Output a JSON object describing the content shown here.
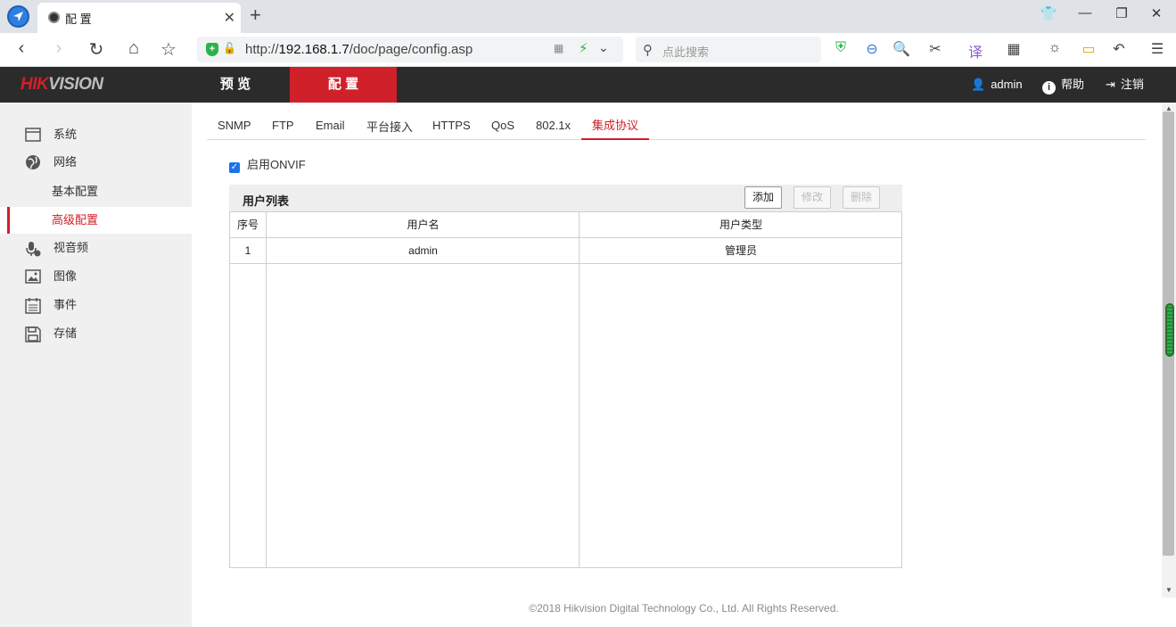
{
  "browser": {
    "tab_title": "配 置",
    "url_prefix": "http://",
    "url_host": "192.168.1.7",
    "url_path": "/doc/page/config.asp",
    "search_placeholder": "点此搜索"
  },
  "header": {
    "logo_hik": "HIK",
    "logo_vision": "VISION",
    "nav": [
      "预 览",
      "配 置"
    ],
    "active_nav": 1,
    "user": "admin",
    "help": "帮助",
    "logout": "注销"
  },
  "sidebar": {
    "items": [
      {
        "label": "系统",
        "icon": "system-icon"
      },
      {
        "label": "网络",
        "icon": "globe-icon"
      },
      {
        "label": "基本配置",
        "sub": true
      },
      {
        "label": "高级配置",
        "sub": true,
        "active": true
      },
      {
        "label": "视音频",
        "icon": "mic-icon"
      },
      {
        "label": "图像",
        "icon": "image-icon"
      },
      {
        "label": "事件",
        "icon": "calendar-icon"
      },
      {
        "label": "存储",
        "icon": "save-icon"
      }
    ]
  },
  "subtabs": [
    "SNMP",
    "FTP",
    "Email",
    "平台接入",
    "HTTPS",
    "QoS",
    "802.1x",
    "集成协议"
  ],
  "active_subtab": 7,
  "onvif": {
    "label": "启用ONVIF",
    "checked": true
  },
  "user_list": {
    "title": "用户列表",
    "buttons": {
      "add": "添加",
      "modify": "修改",
      "delete": "删除"
    },
    "columns": [
      "序号",
      "用户名",
      "用户类型"
    ],
    "rows": [
      {
        "index": "1",
        "username": "admin",
        "type": "管理员"
      }
    ]
  },
  "footer": "©2018 Hikvision Digital Technology Co., Ltd. All Rights Reserved.",
  "colors": {
    "brand_red": "#d0202a",
    "header_bg": "#2b2b2b",
    "sidebar_bg": "#f0f0f0"
  }
}
